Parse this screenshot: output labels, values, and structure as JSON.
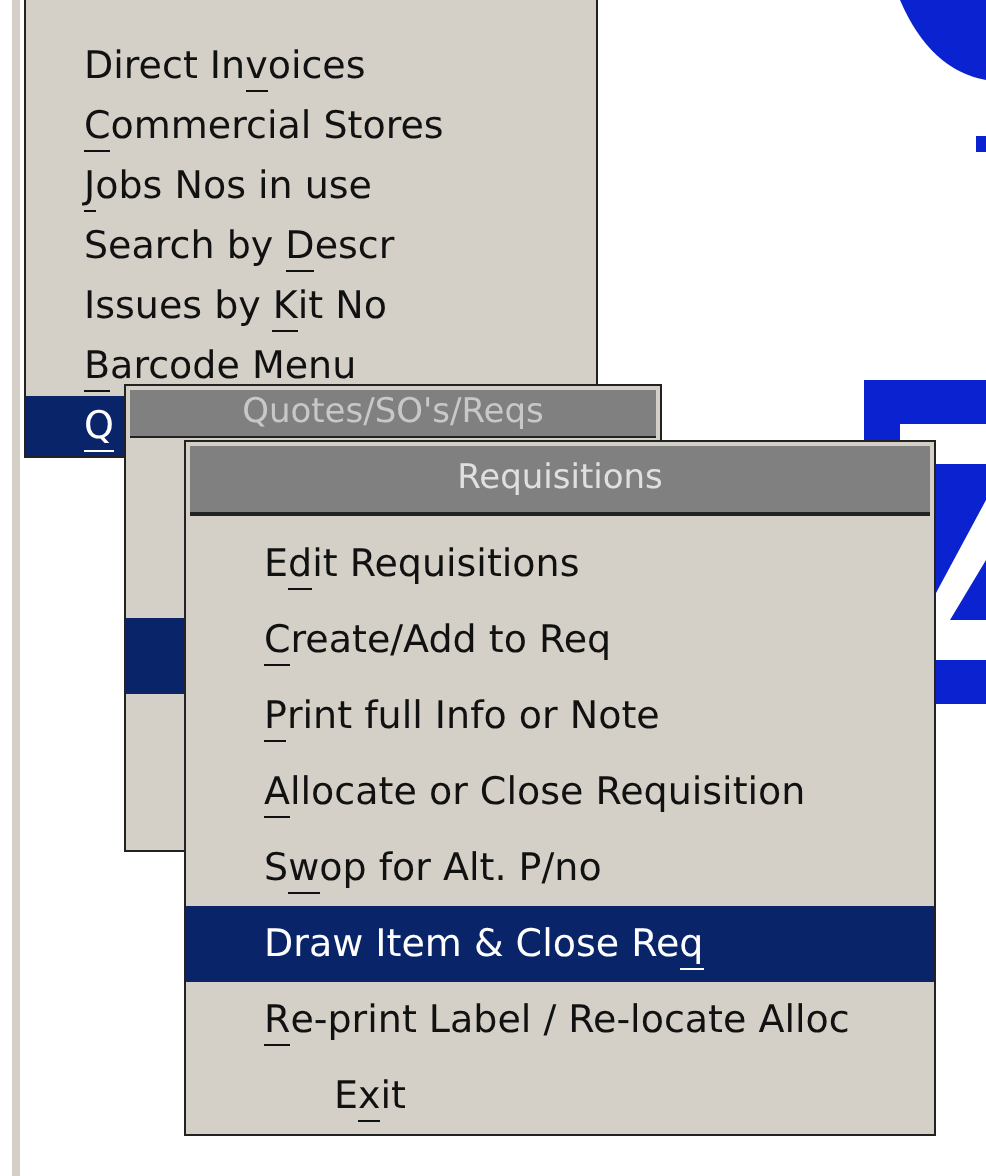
{
  "main_menu": {
    "items": [
      {
        "parts": [
          {
            "text": "Direct In",
            "underlined": false
          },
          {
            "text": "v",
            "underlined": true
          },
          {
            "text": "oices",
            "underlined": false
          }
        ],
        "selected": false
      },
      {
        "parts": [
          {
            "text": "C",
            "underlined": true
          },
          {
            "text": "ommercial Stores",
            "underlined": false
          }
        ],
        "selected": false
      },
      {
        "parts": [
          {
            "text": "J",
            "underlined": true
          },
          {
            "text": "obs Nos in use",
            "underlined": false
          }
        ],
        "selected": false
      },
      {
        "parts": [
          {
            "text": "Search by ",
            "underlined": false
          },
          {
            "text": "D",
            "underlined": true
          },
          {
            "text": "escr",
            "underlined": false
          }
        ],
        "selected": false
      },
      {
        "parts": [
          {
            "text": "Issues by ",
            "underlined": false
          },
          {
            "text": "K",
            "underlined": true
          },
          {
            "text": "it No",
            "underlined": false
          }
        ],
        "selected": false
      },
      {
        "parts": [
          {
            "text": "B",
            "underlined": true
          },
          {
            "text": "arcode Menu",
            "underlined": false
          }
        ],
        "selected": false
      },
      {
        "parts": [
          {
            "text": "Q",
            "underlined": true
          }
        ],
        "selected": true
      }
    ]
  },
  "quotes_menu": {
    "title": "Quotes/SO's/Reqs",
    "rows": [
      {
        "selected": false
      },
      {
        "selected": false
      },
      {
        "selected": true
      },
      {
        "selected": false
      },
      {
        "selected": false
      }
    ]
  },
  "requisitions_menu": {
    "title": "Requisitions",
    "items": [
      {
        "parts": [
          {
            "text": "E",
            "underlined": false
          },
          {
            "text": "d",
            "underlined": true
          },
          {
            "text": "it Requisitions",
            "underlined": false
          }
        ],
        "selected": false,
        "indented": false
      },
      {
        "parts": [
          {
            "text": "C",
            "underlined": true
          },
          {
            "text": "reate/Add to Req",
            "underlined": false
          }
        ],
        "selected": false,
        "indented": false
      },
      {
        "parts": [
          {
            "text": "P",
            "underlined": true
          },
          {
            "text": "rint full Info or Note",
            "underlined": false
          }
        ],
        "selected": false,
        "indented": false
      },
      {
        "parts": [
          {
            "text": "A",
            "underlined": true
          },
          {
            "text": "llocate or Close Requisition",
            "underlined": false
          }
        ],
        "selected": false,
        "indented": false
      },
      {
        "parts": [
          {
            "text": "S",
            "underlined": false
          },
          {
            "text": "w",
            "underlined": true
          },
          {
            "text": "op for Alt. P/no",
            "underlined": false
          }
        ],
        "selected": false,
        "indented": false
      },
      {
        "parts": [
          {
            "text": "Draw Item & Close Re",
            "underlined": false
          },
          {
            "text": "q",
            "underlined": true
          }
        ],
        "selected": true,
        "indented": false
      },
      {
        "parts": [
          {
            "text": "R",
            "underlined": true
          },
          {
            "text": "e-print Label / Re-locate Alloc",
            "underlined": false
          }
        ],
        "selected": false,
        "indented": false
      },
      {
        "parts": [
          {
            "text": "E",
            "underlined": false
          },
          {
            "text": "x",
            "underlined": true
          },
          {
            "text": "it",
            "underlined": false
          }
        ],
        "selected": false,
        "indented": true
      }
    ]
  }
}
